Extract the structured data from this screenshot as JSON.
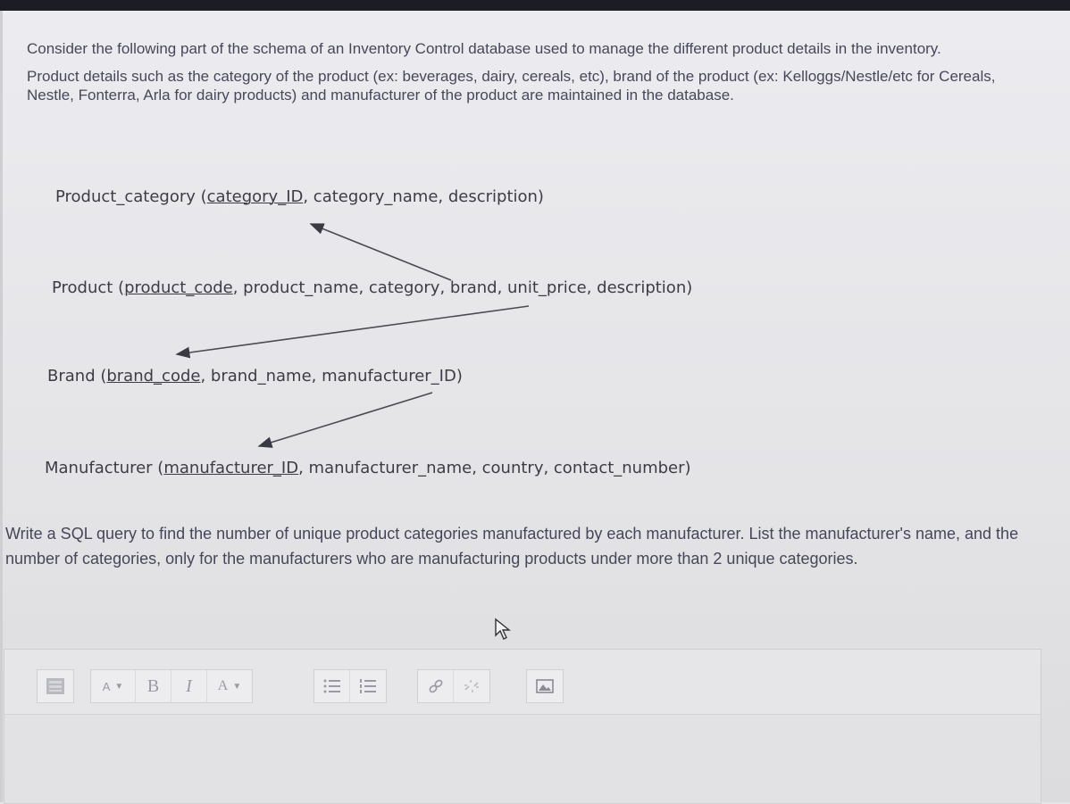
{
  "intro": {
    "p1": "Consider the following part of the schema of an Inventory Control database used to manage the different product details in the inventory.",
    "p2": "Product details such as the category of the product (ex: beverages, dairy, cereals, etc), brand of the product (ex: Kelloggs/Nestle/etc for Cereals, Nestle, Fonterra, Arla for dairy products) and manufacturer of the product are maintained in the database."
  },
  "schema": {
    "product_category": {
      "name": "Product_category (",
      "key": "category_ID",
      "rest": ", category_name, description)"
    },
    "product": {
      "name": "Product (",
      "key": "product_code",
      "rest": ", product_name, category, brand, unit_price, description)"
    },
    "brand": {
      "name": "Brand (",
      "key": "brand_code",
      "rest": ", brand_name, manufacturer_ID)"
    },
    "manufacturer": {
      "name": "Manufacturer (",
      "key": "manufacturer_ID",
      "rest": ", manufacturer_name, country, contact_number)"
    }
  },
  "question": "Write a SQL query to find the number of unique product categories manufactured by each manufacturer. List the manufacturer's name, and the number of categories, only for the manufacturers who are manufacturing products under more than 2 unique categories.",
  "toolbar": {
    "paragraph_label": "A",
    "bold_label": "B",
    "italic_label": "I",
    "font_color_label": "A"
  }
}
